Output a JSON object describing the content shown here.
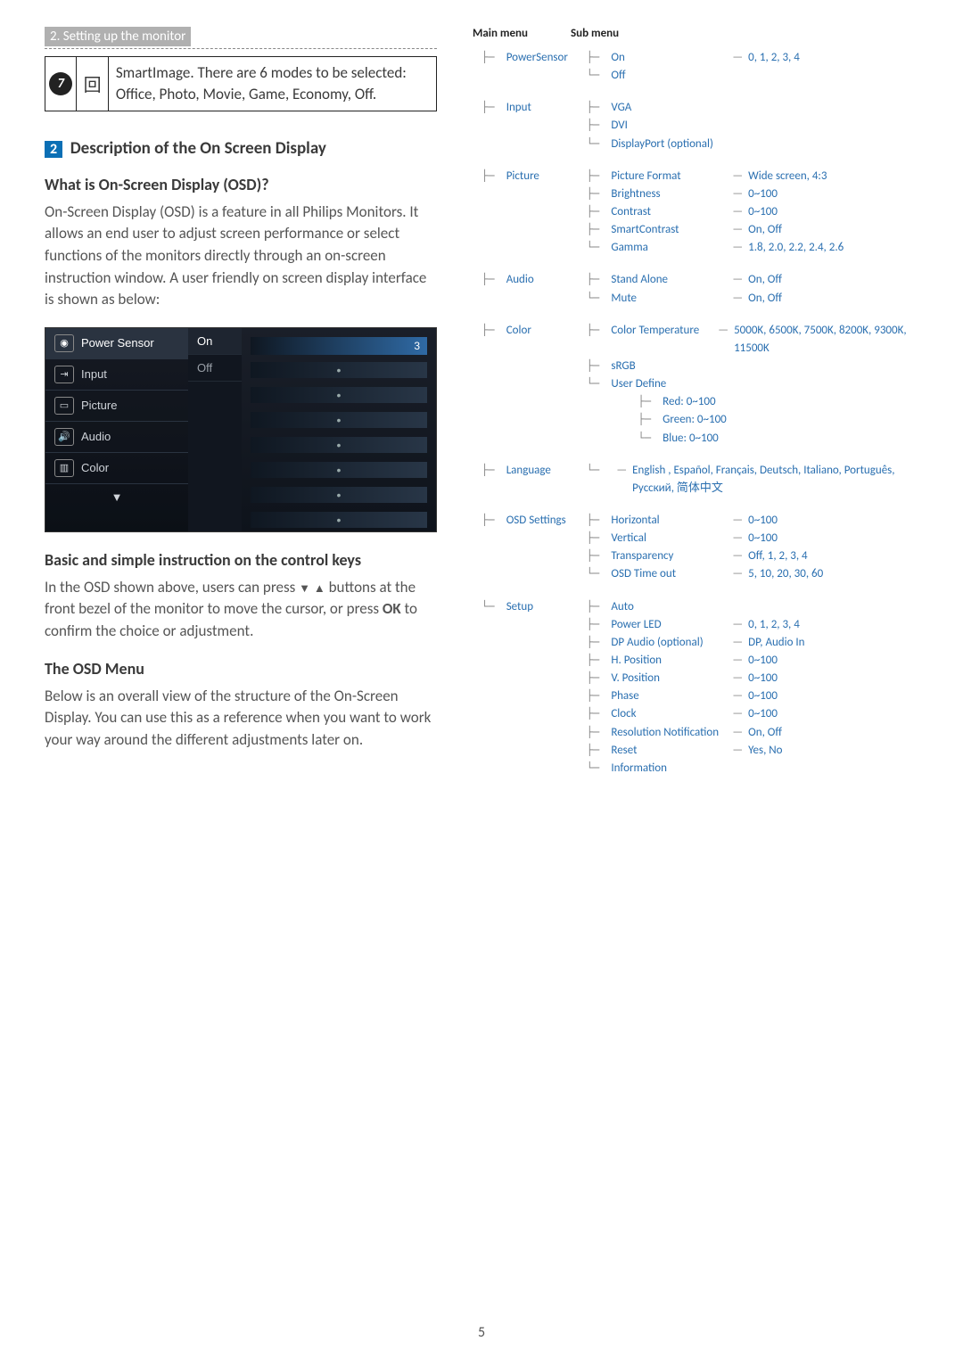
{
  "page_number": "5",
  "header": {
    "title": "2. Setting up the monitor"
  },
  "row7": {
    "num": "7",
    "icon": "回",
    "text": "SmartImage. There are 6 modes to be selected: Office, Photo, Movie, Game, Economy, Off."
  },
  "section2": {
    "badge": "2",
    "title": "Description of the On Screen Display",
    "q_heading": "What is On-Screen Display (OSD)?",
    "q_body": "On-Screen Display (OSD) is a feature in all Philips Monitors. It allows an end user to adjust screen performance or select functions of the monitors directly through an on-screen instruction window. A user friendly on screen display interface is shown as below:"
  },
  "osd_mock": {
    "items": [
      "Power Sensor",
      "Input",
      "Picture",
      "Audio",
      "Color"
    ],
    "options": {
      "on": "On",
      "off": "Off"
    },
    "value": "3"
  },
  "control_keys": {
    "heading": "Basic and simple instruction on the control keys",
    "body_pre": "In the OSD shown above, users can press ",
    "body_mid": " buttons at the front bezel of the monitor to move the cursor, or press ",
    "ok": "OK",
    "body_post": " to confirm the choice or adjustment."
  },
  "osd_menu": {
    "heading": "The OSD Menu",
    "body": "Below is an overall view of the structure of the On-Screen Display. You can use this as a reference when you want to work your way around the different adjustments later on."
  },
  "tree_header": {
    "main": "Main menu",
    "sub": "Sub menu"
  },
  "tree": {
    "PowerSensor": [
      {
        "k": "On",
        "v": "0, 1, 2, 3, 4"
      },
      {
        "k": "Off",
        "v": ""
      }
    ],
    "Input": [
      {
        "k": "VGA",
        "v": ""
      },
      {
        "k": "DVI",
        "v": ""
      },
      {
        "k": "DisplayPort (optional)",
        "v": ""
      }
    ],
    "Picture": [
      {
        "k": "Picture Format",
        "v": "Wide screen, 4:3"
      },
      {
        "k": "Brightness",
        "v": "0~100"
      },
      {
        "k": "Contrast",
        "v": "0~100"
      },
      {
        "k": "SmartContrast",
        "v": "On, Off"
      },
      {
        "k": "Gamma",
        "v": "1.8, 2.0, 2.2, 2.4, 2.6"
      }
    ],
    "Audio": [
      {
        "k": "Stand Alone",
        "v": "On, Off"
      },
      {
        "k": "Mute",
        "v": "On, Off"
      }
    ],
    "Color": [
      {
        "k": "Color Temperature",
        "v": "5000K, 6500K, 7500K, 8200K, 9300K, 11500K"
      },
      {
        "k": "sRGB",
        "v": ""
      },
      {
        "k": "User Define",
        "v": "Red: 0~100 / Green: 0~100 / Blue: 0~100",
        "nested": [
          "Red: 0~100",
          "Green: 0~100",
          "Blue: 0~100"
        ]
      }
    ],
    "Language": [
      {
        "k": "",
        "v": "English , Español, Français, Deutsch, Italiano, Português, Русский, 简体中文"
      }
    ],
    "OSD Settings": [
      {
        "k": "Horizontal",
        "v": "0~100"
      },
      {
        "k": "Vertical",
        "v": "0~100"
      },
      {
        "k": "Transparency",
        "v": "Off, 1, 2, 3, 4"
      },
      {
        "k": "OSD Time out",
        "v": "5, 10, 20, 30, 60"
      }
    ],
    "Setup": [
      {
        "k": "Auto",
        "v": ""
      },
      {
        "k": "Power LED",
        "v": "0, 1, 2, 3, 4"
      },
      {
        "k": "DP Audio (optional)",
        "v": "DP, Audio In"
      },
      {
        "k": "H. Position",
        "v": "0~100"
      },
      {
        "k": "V. Position",
        "v": "0~100"
      },
      {
        "k": "Phase",
        "v": "0~100"
      },
      {
        "k": "Clock",
        "v": "0~100"
      },
      {
        "k": "Resolution Notification",
        "v": "On, Off"
      },
      {
        "k": "Reset",
        "v": "Yes, No"
      },
      {
        "k": "Information",
        "v": ""
      }
    ]
  }
}
